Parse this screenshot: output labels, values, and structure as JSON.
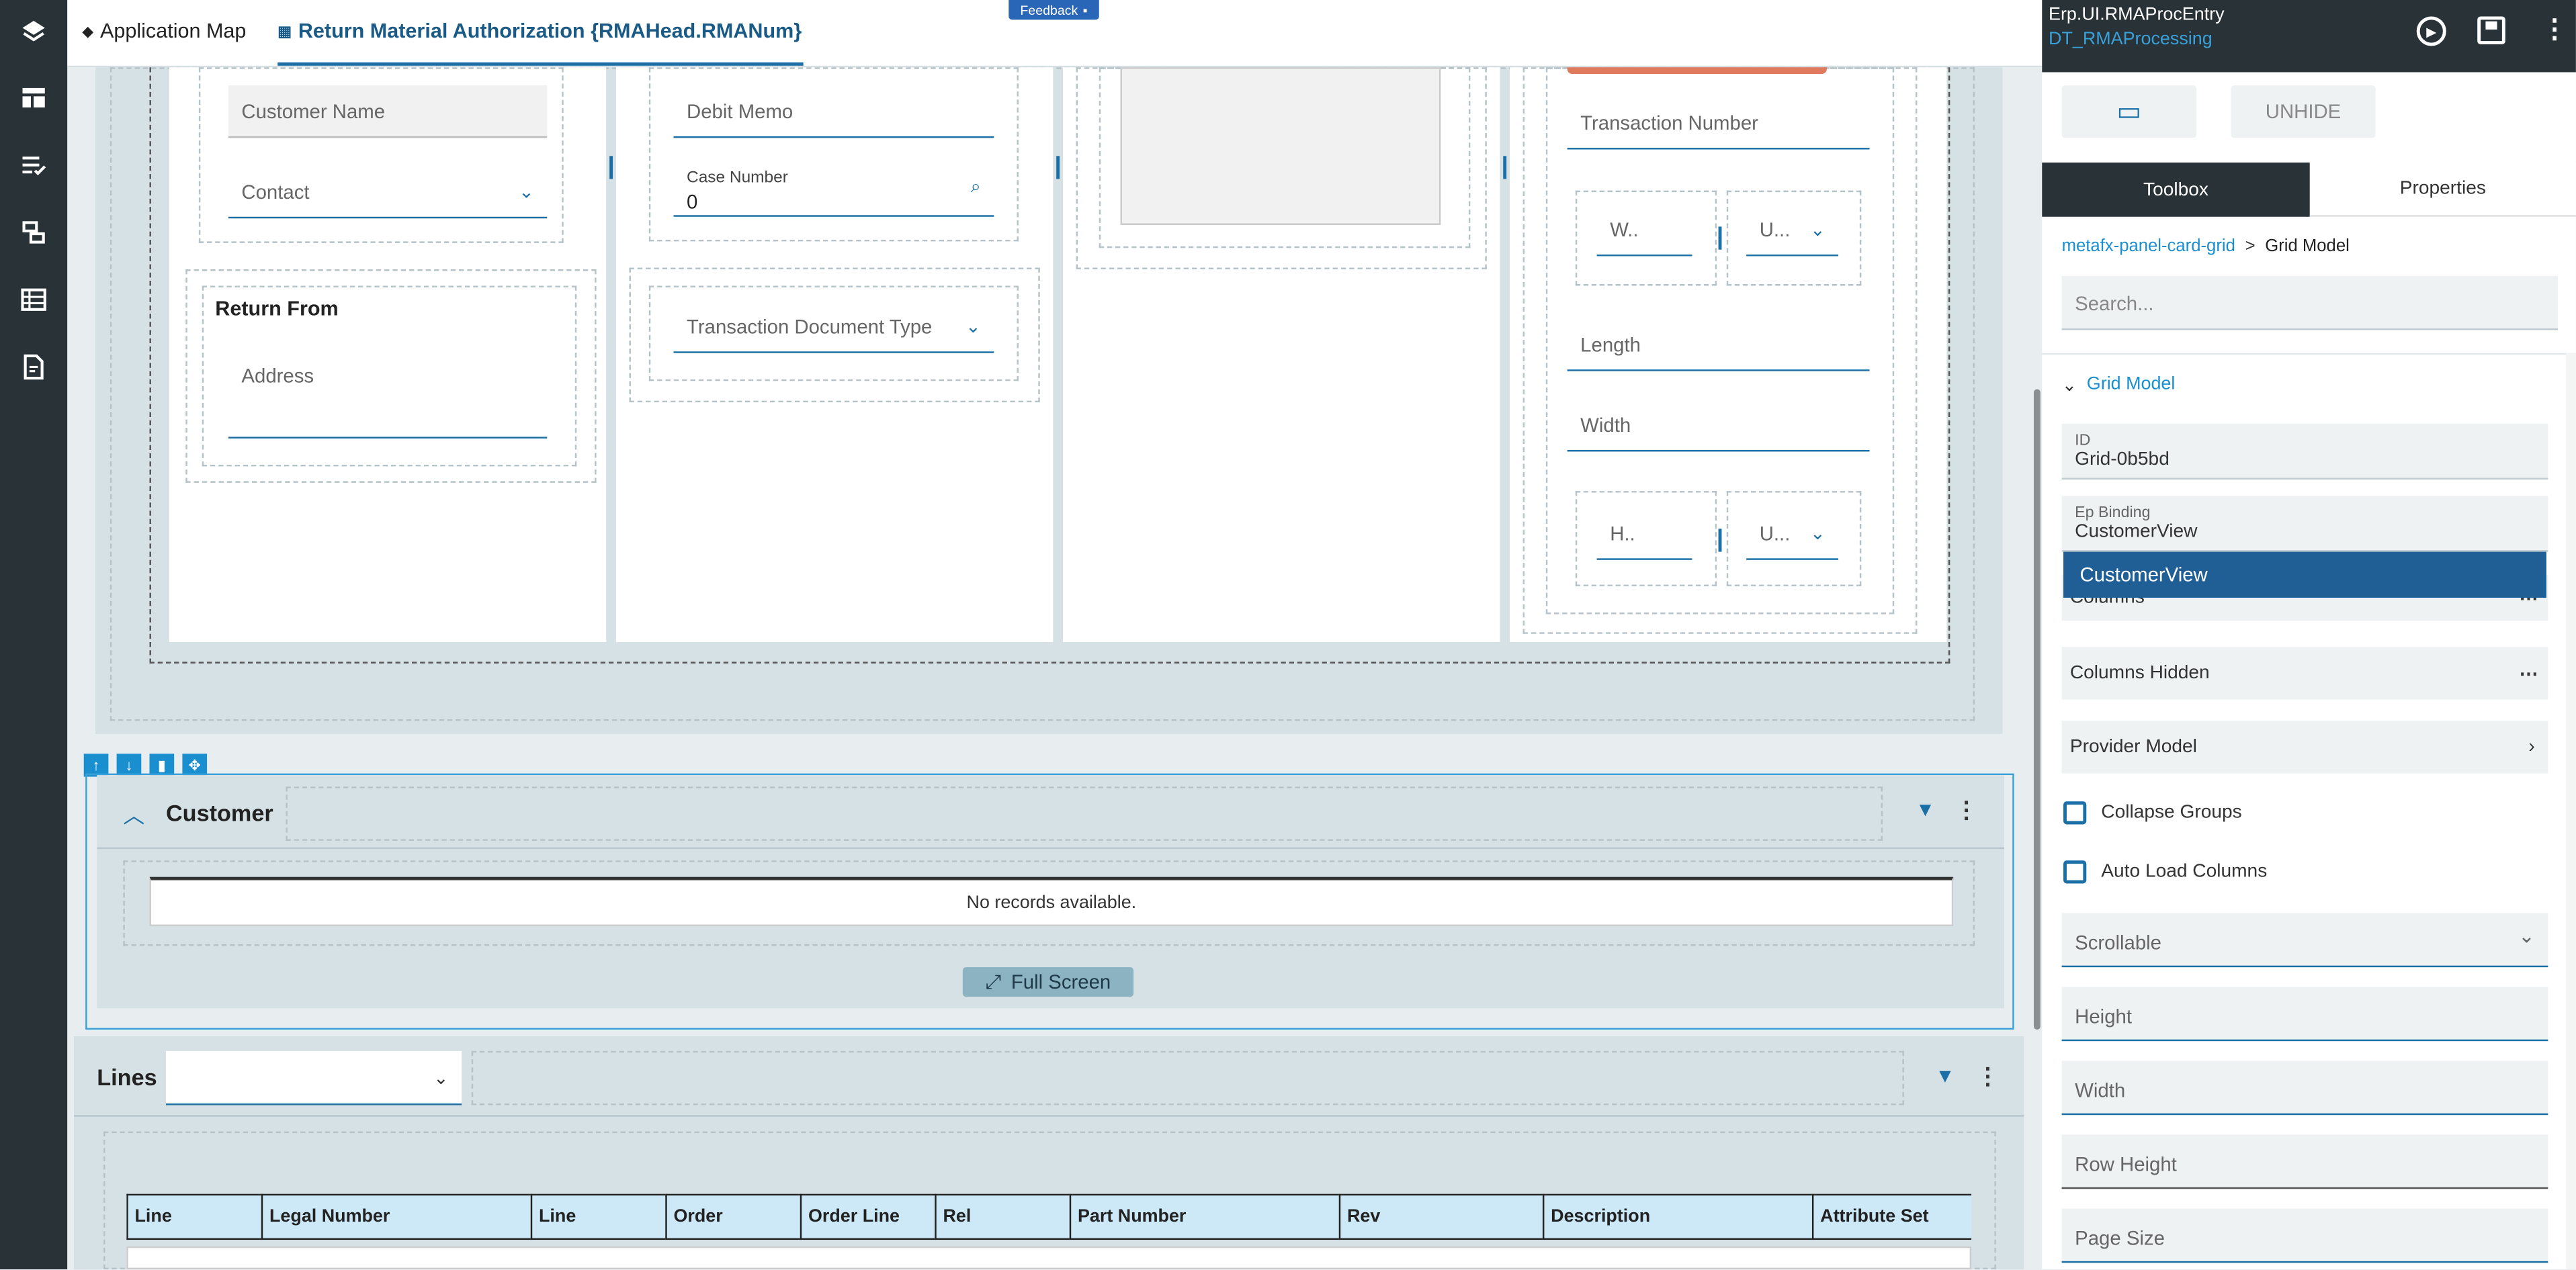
{
  "topbar": {
    "tab_app_map": "Application Map",
    "tab_rma": "Return Material Authorization {RMAHead.RMANum}",
    "feedback": "Feedback"
  },
  "form": {
    "customer_name_placeholder": "Customer Name",
    "contact_placeholder": "Contact",
    "return_from_title": "Return From",
    "address_placeholder": "Address",
    "debit_memo_placeholder": "Debit Memo",
    "case_number_label": "Case Number",
    "case_number_value": "0",
    "transaction_doc_type_placeholder": "Transaction Document Type",
    "transaction_number_placeholder": "Transaction Number",
    "weight_placeholder": "W..",
    "uom1_placeholder": "U...",
    "length_placeholder": "Length",
    "width_placeholder": "Width",
    "height_placeholder": "H..",
    "uom2_placeholder": "U..."
  },
  "customer_section": {
    "title": "Customer",
    "no_records": "No records available.",
    "full_screen": "Full Screen"
  },
  "lines_section": {
    "title": "Lines",
    "columns": [
      "Line",
      "Legal Number",
      "Line",
      "Order",
      "Order Line",
      "Rel",
      "Part Number",
      "Rev",
      "Description",
      "Attribute Set"
    ]
  },
  "right_panel": {
    "app_name": "Erp.UI.RMAProcEntry",
    "layer_name": "DT_RMAProcessing",
    "unhide": "UNHIDE",
    "tab_toolbox": "Toolbox",
    "tab_properties": "Properties",
    "breadcrumb_parent": "metafx-panel-card-grid",
    "breadcrumb_sep": ">",
    "breadcrumb_current": "Grid Model",
    "search_placeholder": "Search...",
    "group_title": "Grid Model",
    "id_label": "ID",
    "id_value": "Grid-0b5bd",
    "ep_binding_label": "Ep Binding",
    "ep_binding_value": "CustomerView",
    "dropdown_option": "CustomerView",
    "columns": "Columns",
    "columns_hidden": "Columns Hidden",
    "provider_model": "Provider Model",
    "collapse_groups": "Collapse Groups",
    "auto_load_columns": "Auto Load Columns",
    "scrollable": "Scrollable",
    "height": "Height",
    "width": "Width",
    "row_height": "Row Height",
    "page_size": "Page Size"
  },
  "colors": {
    "accent": "#1a6fa6",
    "rail_bg": "#283237",
    "header_cell_bg": "#cde8f6",
    "selected_option_bg": "#1f5f95"
  }
}
